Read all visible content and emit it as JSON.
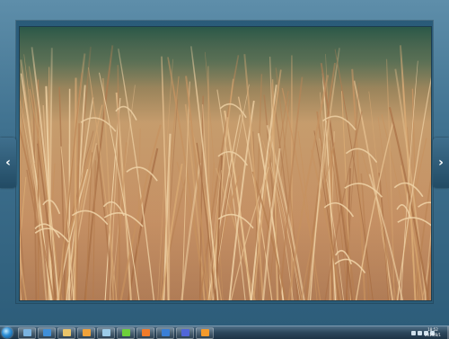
{
  "viewer": {
    "prev_glyph": "‹",
    "next_glyph": "›",
    "photo_subject": "dry golden grass field"
  },
  "taskbar": {
    "start": "start-orb",
    "apps": [
      {
        "name": "windows-explorer",
        "color": "#7ab3e0"
      },
      {
        "name": "internet-explorer",
        "color": "#3f8fd8"
      },
      {
        "name": "file-manager",
        "color": "#e9c46a"
      },
      {
        "name": "media-folder",
        "color": "#f0a23a"
      },
      {
        "name": "photo-viewer",
        "color": "#9ccbe8"
      },
      {
        "name": "green-app",
        "color": "#6ccf3a"
      },
      {
        "name": "office-app",
        "color": "#f07b2a"
      },
      {
        "name": "word-app",
        "color": "#3a7fd6"
      },
      {
        "name": "media-player",
        "color": "#5066d8"
      },
      {
        "name": "orange-app",
        "color": "#f39a2c"
      }
    ],
    "clock_time": "18:52",
    "clock_date": "2015/8/1"
  },
  "colors": {
    "frame": "#2f5f7c",
    "grass": "#c99a63",
    "background_green": "#2f5b46"
  }
}
